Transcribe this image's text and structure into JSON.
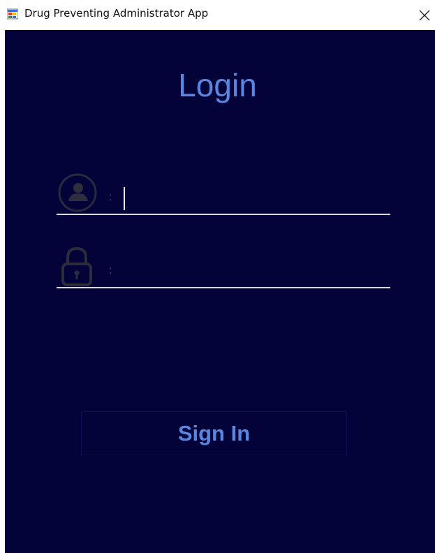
{
  "window": {
    "title": "Drug Preventing Administrator App",
    "app_icon": "windows-forms-app-icon",
    "close_icon": "close-x-icon"
  },
  "login": {
    "heading": "Login",
    "username": {
      "icon": "user-circle-icon",
      "separator": ":",
      "value": ""
    },
    "password": {
      "icon": "padlock-icon",
      "separator": ":",
      "value": ""
    },
    "signin_label": "Sign In"
  },
  "colors": {
    "background": "#03033a",
    "accent": "#5a86e0",
    "underline": "#d8d8e8",
    "icon_stroke": "#2a2a3e"
  }
}
